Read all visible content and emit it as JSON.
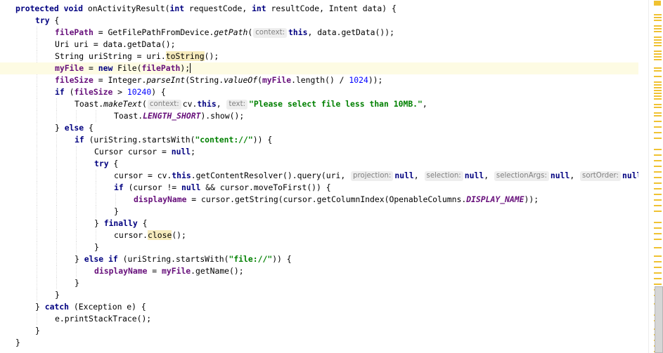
{
  "editor": {
    "lines": [
      {
        "indent": 0,
        "tokens": [
          [
            "kw",
            "protected"
          ],
          [
            "",
            " "
          ],
          [
            "kw",
            "void"
          ],
          [
            "",
            " onActivityResult("
          ],
          [
            "kw",
            "int"
          ],
          [
            "",
            " requestCode, "
          ],
          [
            "kw",
            "int"
          ],
          [
            "",
            " resultCode, Intent data) {"
          ]
        ]
      },
      {
        "indent": 1,
        "tokens": [
          [
            "kw",
            "try"
          ],
          [
            "",
            " {"
          ]
        ]
      },
      {
        "indent": 2,
        "tokens": [
          [
            "field",
            "filePath"
          ],
          [
            "",
            " = GetFilePathFromDevice."
          ],
          [
            "static",
            "getPath"
          ],
          [
            "",
            "("
          ],
          [
            "hint",
            "context:"
          ],
          [
            "kw",
            "this"
          ],
          [
            "",
            ", data.getData());"
          ]
        ]
      },
      {
        "indent": 2,
        "tokens": [
          [
            "",
            "Uri uri = data.getData();"
          ]
        ]
      },
      {
        "indent": 2,
        "tokens": [
          [
            "",
            "String uriString = uri."
          ],
          [
            "hl",
            "toString"
          ],
          [
            "",
            "();"
          ]
        ]
      },
      {
        "indent": 2,
        "current": true,
        "tokens": [
          [
            "field",
            "myFile"
          ],
          [
            "",
            " = "
          ],
          [
            "kw",
            "new"
          ],
          [
            "",
            " File("
          ],
          [
            "field",
            "filePath"
          ],
          [
            "",
            ");"
          ],
          [
            "caret",
            ""
          ]
        ]
      },
      {
        "indent": 2,
        "tokens": [
          [
            "field",
            "fileSize"
          ],
          [
            "",
            " = Integer."
          ],
          [
            "static",
            "parseInt"
          ],
          [
            "",
            "(String."
          ],
          [
            "static",
            "valueOf"
          ],
          [
            "",
            "("
          ],
          [
            "field",
            "myFile"
          ],
          [
            "",
            ".length() / "
          ],
          [
            "num",
            "1024"
          ],
          [
            "",
            "));"
          ]
        ]
      },
      {
        "indent": 2,
        "tokens": [
          [
            "kw",
            "if"
          ],
          [
            "",
            " ("
          ],
          [
            "field",
            "fileSize"
          ],
          [
            "",
            " > "
          ],
          [
            "num",
            "10240"
          ],
          [
            "",
            ") {"
          ]
        ]
      },
      {
        "indent": 3,
        "tokens": [
          [
            "",
            "Toast."
          ],
          [
            "static",
            "makeText"
          ],
          [
            "",
            "("
          ],
          [
            "hint",
            "context:"
          ],
          [
            "",
            "cv."
          ],
          [
            "kw",
            "this"
          ],
          [
            "",
            ", "
          ],
          [
            "hint",
            "text:"
          ],
          [
            "str",
            "\"Please select file less than 10MB.\""
          ],
          [
            "",
            ","
          ]
        ]
      },
      {
        "indent": 5,
        "tokens": [
          [
            "",
            "Toast."
          ],
          [
            "staticfield",
            "LENGTH_SHORT"
          ],
          [
            "",
            ").show();"
          ]
        ]
      },
      {
        "indent": 2,
        "tokens": [
          [
            "",
            "} "
          ],
          [
            "kw",
            "else"
          ],
          [
            "",
            " {"
          ]
        ]
      },
      {
        "indent": 3,
        "tokens": [
          [
            "kw",
            "if"
          ],
          [
            "",
            " (uriString.startsWith("
          ],
          [
            "str",
            "\"content://\""
          ],
          [
            "",
            ")) {"
          ]
        ]
      },
      {
        "indent": 4,
        "tokens": [
          [
            "",
            "Cursor cursor = "
          ],
          [
            "kw",
            "null"
          ],
          [
            "",
            ";"
          ]
        ]
      },
      {
        "indent": 4,
        "tokens": [
          [
            "kw",
            "try"
          ],
          [
            "",
            " {"
          ]
        ]
      },
      {
        "indent": 5,
        "tokens": [
          [
            "",
            "cursor = cv."
          ],
          [
            "kw",
            "this"
          ],
          [
            "",
            ".getContentResolver().query(uri, "
          ],
          [
            "hint",
            "projection:"
          ],
          [
            "kw",
            "null"
          ],
          [
            "",
            ", "
          ],
          [
            "hint",
            "selection:"
          ],
          [
            "kw",
            "null"
          ],
          [
            "",
            ", "
          ],
          [
            "hint",
            "selectionArgs:"
          ],
          [
            "kw",
            "null"
          ],
          [
            "",
            ", "
          ],
          [
            "hint",
            "sortOrder:"
          ],
          [
            "kw",
            "null"
          ]
        ]
      },
      {
        "indent": 5,
        "tokens": [
          [
            "kw",
            "if"
          ],
          [
            "",
            " (cursor != "
          ],
          [
            "kw",
            "null"
          ],
          [
            "",
            " && cursor.moveToFirst()) {"
          ]
        ]
      },
      {
        "indent": 6,
        "tokens": [
          [
            "field",
            "displayName"
          ],
          [
            "",
            " = cursor.getString(cursor.getColumnIndex(OpenableColumns."
          ],
          [
            "staticfield",
            "DISPLAY_NAME"
          ],
          [
            "",
            "));"
          ]
        ]
      },
      {
        "indent": 5,
        "tokens": [
          [
            "",
            "}"
          ]
        ]
      },
      {
        "indent": 4,
        "tokens": [
          [
            "",
            "} "
          ],
          [
            "kw",
            "finally"
          ],
          [
            "",
            " {"
          ]
        ]
      },
      {
        "indent": 5,
        "tokens": [
          [
            "",
            "cursor."
          ],
          [
            "hl",
            "close"
          ],
          [
            "",
            "();"
          ]
        ]
      },
      {
        "indent": 4,
        "tokens": [
          [
            "",
            "}"
          ]
        ]
      },
      {
        "indent": 3,
        "tokens": [
          [
            "",
            "} "
          ],
          [
            "kw",
            "else if"
          ],
          [
            "",
            " (uriString.startsWith("
          ],
          [
            "str",
            "\"file://\""
          ],
          [
            "",
            ")) {"
          ]
        ]
      },
      {
        "indent": 4,
        "tokens": [
          [
            "field",
            "displayName"
          ],
          [
            "",
            " = "
          ],
          [
            "field",
            "myFile"
          ],
          [
            "",
            ".getName();"
          ]
        ]
      },
      {
        "indent": 3,
        "tokens": [
          [
            "",
            "}"
          ]
        ]
      },
      {
        "indent": 2,
        "tokens": [
          [
            "",
            "}"
          ]
        ]
      },
      {
        "indent": 1,
        "tokens": [
          [
            "",
            "} "
          ],
          [
            "kw",
            "catch"
          ],
          [
            "",
            " (Exception e) {"
          ]
        ]
      },
      {
        "indent": 2,
        "tokens": [
          [
            "",
            "e.printStackTrace();"
          ]
        ]
      },
      {
        "indent": 1,
        "tokens": [
          [
            "",
            "}"
          ]
        ]
      },
      {
        "indent": 0,
        "tokens": [
          [
            "",
            "}"
          ]
        ]
      }
    ]
  },
  "gutter": {
    "marker_color": "#f0c232",
    "marks": [
      1,
      20,
      24,
      28,
      36,
      40,
      44,
      52,
      56,
      60,
      64,
      72,
      76,
      80,
      84,
      96,
      100,
      108,
      116,
      120,
      124,
      128,
      132,
      136,
      140,
      148,
      152,
      160,
      164,
      172,
      180,
      188,
      196,
      212,
      220,
      228,
      236,
      244,
      252,
      260,
      268,
      276,
      284,
      292,
      300,
      316,
      324,
      332,
      340,
      352,
      364,
      372,
      380,
      388,
      396,
      404,
      412,
      420,
      432,
      448,
      456,
      468,
      476,
      484,
      492,
      500
    ]
  }
}
